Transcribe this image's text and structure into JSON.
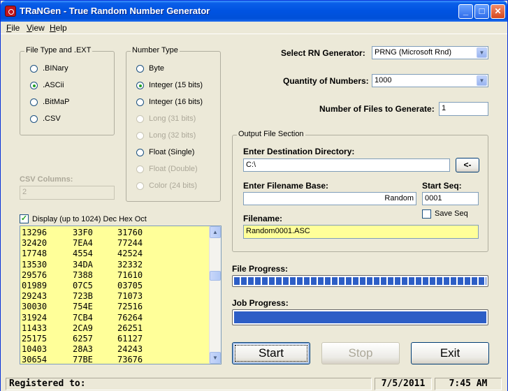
{
  "window": {
    "title": "TRaNGen - True Random Number Generator"
  },
  "menu": [
    {
      "key": "F",
      "rest": "ile"
    },
    {
      "key": "V",
      "rest": "iew"
    },
    {
      "key": "H",
      "rest": "elp"
    }
  ],
  "file_type": {
    "title": "File Type and .EXT",
    "options": [
      {
        "label": ".BINary",
        "checked": false
      },
      {
        "label": ".ASCii",
        "checked": true
      },
      {
        "label": ".BitMaP",
        "checked": false
      },
      {
        "label": ".CSV",
        "checked": false
      }
    ]
  },
  "number_type": {
    "title": "Number Type",
    "options": [
      {
        "label": "Byte",
        "checked": false,
        "enabled": true
      },
      {
        "label": "Integer (15 bits)",
        "checked": true,
        "enabled": true
      },
      {
        "label": "Integer (16 bits)",
        "checked": false,
        "enabled": true
      },
      {
        "label": "Long (31 bits)",
        "checked": false,
        "enabled": false
      },
      {
        "label": "Long (32 bits)",
        "checked": false,
        "enabled": false
      },
      {
        "label": "Float (Single)",
        "checked": false,
        "enabled": true
      },
      {
        "label": "Float (Double)",
        "checked": false,
        "enabled": false
      },
      {
        "label": "Color (24 bits)",
        "checked": false,
        "enabled": false
      }
    ]
  },
  "csv": {
    "label": "CSV Columns:",
    "value": "2"
  },
  "display": {
    "checkbox_label": "Display (up to 1024) Dec Hex Oct",
    "checked": true,
    "rows": [
      [
        "13296",
        "33F0",
        "31760"
      ],
      [
        "32420",
        "7EA4",
        "77244"
      ],
      [
        "17748",
        "4554",
        "42524"
      ],
      [
        "13530",
        "34DA",
        "32332"
      ],
      [
        "29576",
        "7388",
        "71610"
      ],
      [
        "01989",
        "07C5",
        "03705"
      ],
      [
        "29243",
        "723B",
        "71073"
      ],
      [
        "30030",
        "754E",
        "72516"
      ],
      [
        "31924",
        "7CB4",
        "76264"
      ],
      [
        "11433",
        "2CA9",
        "26251"
      ],
      [
        "25175",
        "6257",
        "61127"
      ],
      [
        "10403",
        "28A3",
        "24243"
      ],
      [
        "30654",
        "77BE",
        "73676"
      ]
    ]
  },
  "generator": {
    "label": "Select RN Generator:",
    "value": "PRNG (Microsoft Rnd)"
  },
  "quantity": {
    "label": "Quantity of Numbers:",
    "value": "1000"
  },
  "files": {
    "label": "Number of Files to Generate:",
    "value": "1"
  },
  "output": {
    "title": "Output File Section",
    "dest_label": "Enter Destination Directory:",
    "dest_value": "C:\\",
    "browse_label": "<-",
    "base_label": "Enter Filename Base:",
    "base_value": "Random",
    "seq_label": "Start Seq:",
    "seq_value": "0001",
    "save_seq_label": "Save Seq",
    "filename_label": "Filename:",
    "filename_value": "Random0001.ASC"
  },
  "file_progress": {
    "label": "File Progress:",
    "percent": 100
  },
  "job_progress": {
    "label": "Job Progress:",
    "percent": 100
  },
  "buttons": {
    "start": "Start",
    "stop": "Stop",
    "exit": "Exit"
  },
  "status": {
    "registered": "Registered to:",
    "date": "7/5/2011",
    "time": "7:45 AM"
  }
}
